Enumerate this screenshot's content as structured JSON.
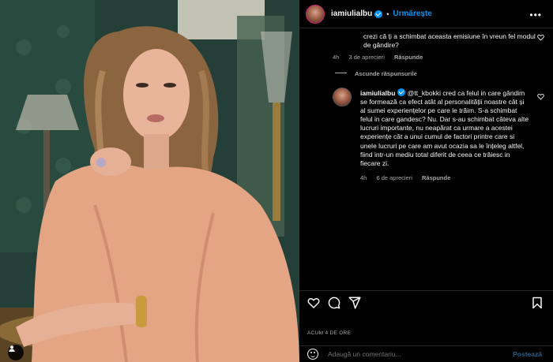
{
  "post": {
    "username": "iamiulialbu",
    "separator": "•",
    "follow_label": "Urmărește",
    "more_label": "•••"
  },
  "comments": {
    "first": {
      "text": "crezi că ți a schimbat aceasta emisiune în vreun fel modul de gândire?",
      "age": "4h",
      "likes": "3 de aprecieri",
      "reply": "Răspunde"
    },
    "hide_replies": "Ascunde răspunsurile",
    "reply": {
      "username": "iamiulialbu",
      "text": "@tt_kbokki cred ca felul in care gândim se formează ca efect atât al personalității noastre cât și al sumei experiențelor pe care le trăim. S-a schimbat felul in care gandesc? Nu. Dar s-au schimbat câteva alte lucruri importante, nu neapărat ca urmare a acestei experiențe cât a unui cumul de factori printre care si unele lucruri pe care am avut ocazia sa le înțeleg altfel, fiind intr-un mediu total diferit de ceea ce trăiesc in fiecare zi.",
      "age": "4h",
      "likes": "6 de aprecieri",
      "reply_label": "Răspunde"
    }
  },
  "actions": {
    "icons": [
      "heart-icon",
      "comment-icon",
      "share-icon",
      "bookmark-icon"
    ],
    "timestamp": "ACUM 4 DE ORE"
  },
  "add_comment": {
    "placeholder": "Adaugă un comentariu...",
    "post_label": "Postează"
  },
  "colors": {
    "accent": "#0095f6",
    "muted": "#a8a8a8",
    "background": "#000000"
  }
}
